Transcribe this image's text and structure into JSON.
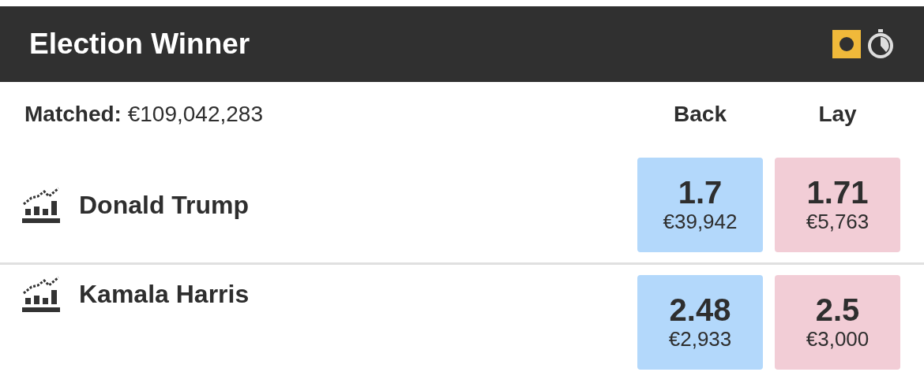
{
  "header": {
    "title": "Election Winner"
  },
  "matched": {
    "label": "Matched:",
    "value": "€109,042,283"
  },
  "columns": [
    "Back",
    "Lay"
  ],
  "runners": [
    {
      "name": "Donald Trump",
      "back": {
        "price": "1.7",
        "amount": "€39,942"
      },
      "lay": {
        "price": "1.71",
        "amount": "€5,763"
      }
    },
    {
      "name": "Kamala Harris",
      "back": {
        "price": "2.48",
        "amount": "€2,933"
      },
      "lay": {
        "price": "2.5",
        "amount": "€3,000"
      }
    }
  ]
}
